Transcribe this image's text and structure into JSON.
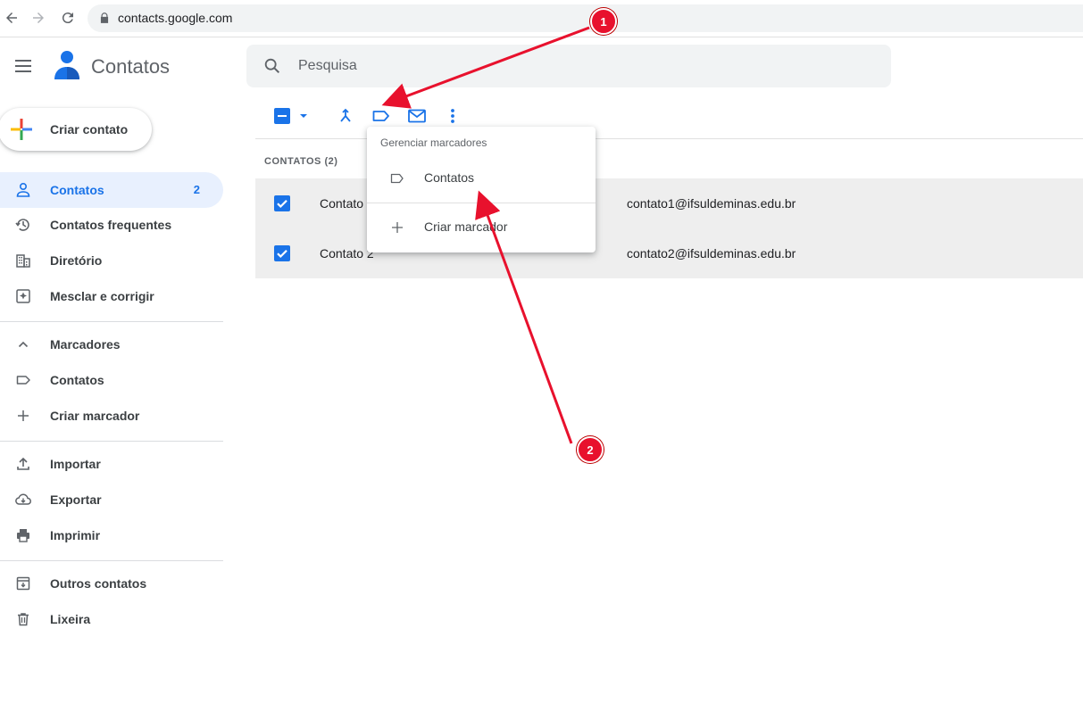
{
  "browser": {
    "url": "contacts.google.com"
  },
  "app": {
    "title": "Contatos"
  },
  "search": {
    "placeholder": "Pesquisa"
  },
  "create_button": {
    "label": "Criar contato"
  },
  "sidebar": {
    "contacts": {
      "label": "Contatos",
      "count": "2"
    },
    "frequent": {
      "label": "Contatos frequentes"
    },
    "directory": {
      "label": "Diretório"
    },
    "merge": {
      "label": "Mesclar e corrigir"
    },
    "labels_header": {
      "label": "Marcadores"
    },
    "label_contacts": {
      "label": "Contatos"
    },
    "create_label": {
      "label": "Criar marcador"
    },
    "import": {
      "label": "Importar"
    },
    "export": {
      "label": "Exportar"
    },
    "print": {
      "label": "Imprimir"
    },
    "other": {
      "label": "Outros contatos"
    },
    "trash": {
      "label": "Lixeira"
    }
  },
  "list": {
    "header": "CONTATOS (2)",
    "rows": [
      {
        "name": "Contato 1",
        "email": "contato1@ifsuldeminas.edu.br"
      },
      {
        "name": "Contato 2",
        "email": "contato2@ifsuldeminas.edu.br"
      }
    ]
  },
  "label_menu": {
    "title": "Gerenciar marcadores",
    "item_contacts": "Contatos",
    "item_create": "Criar marcador"
  },
  "annotations": {
    "badge1": "1",
    "badge2": "2",
    "color": "#e8112d"
  },
  "colors": {
    "accent": "#1a73e8",
    "active_bg": "#e8f0fe",
    "selected_row": "#eeeeee"
  }
}
